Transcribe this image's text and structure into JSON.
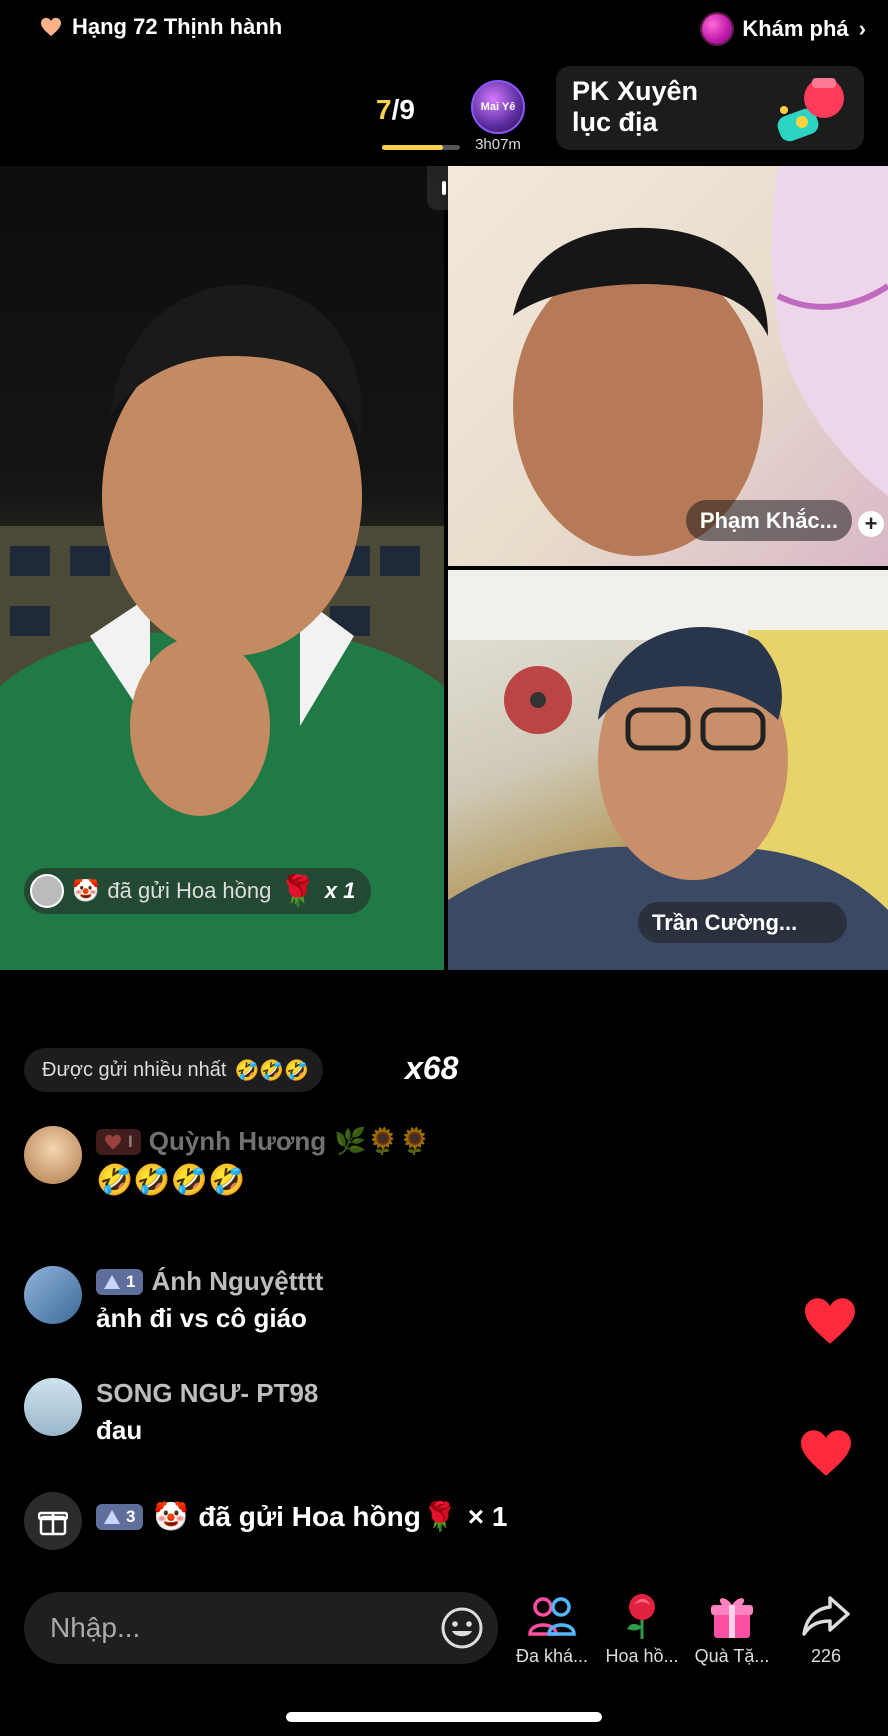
{
  "top": {
    "rank_text": "Hạng 72 Thịnh hành",
    "explore_label": "Khám phá",
    "explore_chevron": "›"
  },
  "match": {
    "round_current": "7",
    "round_total": "/9",
    "round_progress": 0.78,
    "host_timer": "3h07m",
    "host_avatar_text": "Mai Yê",
    "pk_line1": "PK Xuyên",
    "pk_line2": "lục địa"
  },
  "videos": {
    "guest1_name": "Phạm Khắc...",
    "guest1_plus": "+",
    "guest2_name": "Trần Cường..."
  },
  "gift_notice": {
    "text": "đã gửi Hoa hồng",
    "count": "x 1",
    "gift_emoji": "🌹",
    "face_emoji": "🤡"
  },
  "most_sent": {
    "label": "Được gửi nhiều nhất",
    "emojis": "🤣🤣🤣",
    "count": "x68"
  },
  "comments": [
    {
      "badge": "I",
      "user": "Quỳnh Hương",
      "user_emojis": "🌿🌻🌻",
      "text": "🤣🤣🤣🤣"
    },
    {
      "badge": "1",
      "user": "Ánh Nguyệtttt",
      "text": "ảnh đi vs cô giáo"
    },
    {
      "user": "SONG NGƯ- PT98",
      "text": "đau"
    }
  ],
  "gift_line": {
    "badge": "3",
    "face_emoji": "🤡",
    "text": "đã gửi Hoa hồng",
    "gift_emoji": "🌹",
    "count": "× 1"
  },
  "bottom": {
    "input_placeholder": "Nhập...",
    "actions": [
      {
        "label": "Đa khá...",
        "icon": "multi-guest-icon"
      },
      {
        "label": "Hoa hồ...",
        "icon": "rose-icon"
      },
      {
        "label": "Quà Tặ...",
        "icon": "gift-icon"
      },
      {
        "label": "226",
        "icon": "share-icon"
      }
    ]
  },
  "colors": {
    "accent_yellow": "#f7d34a",
    "heart_red": "#ff2a3b",
    "level_badge": "#5d6f9a"
  }
}
